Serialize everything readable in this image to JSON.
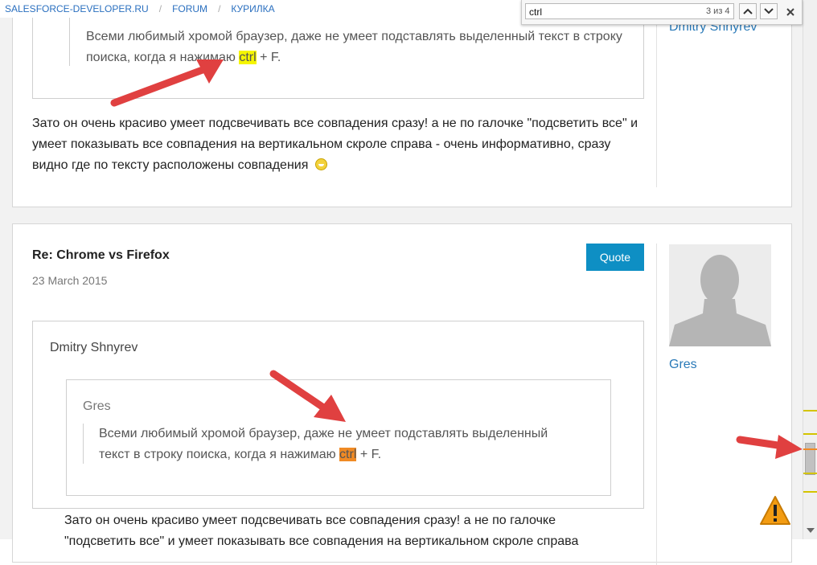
{
  "breadcrumb": {
    "items": [
      "SALESFORCE-DEVELOPER.RU",
      "FORUM",
      "КУРИЛКА"
    ],
    "sep": "/"
  },
  "find_bar": {
    "query": "ctrl",
    "count": "3 из 4"
  },
  "post1": {
    "quote_text_a": "Всеми любимый хромой браузер, даже не умеет подставлять выделенный текст в строку",
    "quote_text_b": "поиска, когда я нажимаю",
    "match": "ctrl",
    "after": " + F.",
    "body_1": "Зато он очень красиво умеет подсвечивать все совпадения сразу! а не по галочке \"подсветить все\" и",
    "body_2": "умеет показывать все совпадения на вертикальном скроле справа - очень информативно, сразу",
    "body_3": "видно где по тексту расположены совпадения",
    "author": "Dmitry Shnyrev"
  },
  "post2": {
    "title": "Re: Chrome vs Firefox",
    "date": "23 March 2015",
    "quote_button": "Quote",
    "outer_author": "Dmitry Shnyrev",
    "inner_author": "Gres",
    "quote_text_a": "Всеми любимый хромой браузер, даже не умеет подставлять выделенный",
    "quote_text_b": "текст в строку поиска, когда я нажимаю",
    "match": "ctrl",
    "after": " + F.",
    "body_1": "Зато он очень красиво умеет подсвечивать все совпадения сразу! а не по галочке",
    "body_2": "\"подсветить все\" и умеет показывать все совпадения на вертикальном скроле справа",
    "author": "Gres"
  },
  "icons": {
    "smile": "smile-emoji-icon",
    "warning": "warning-icon",
    "avatar": "user-avatar-icon"
  },
  "colors": {
    "link": "#2a7ab8",
    "quote_button": "#0e8fc4",
    "highlight": "#f5f500",
    "current_match": "#f08a24",
    "arrow": "#e04040"
  }
}
